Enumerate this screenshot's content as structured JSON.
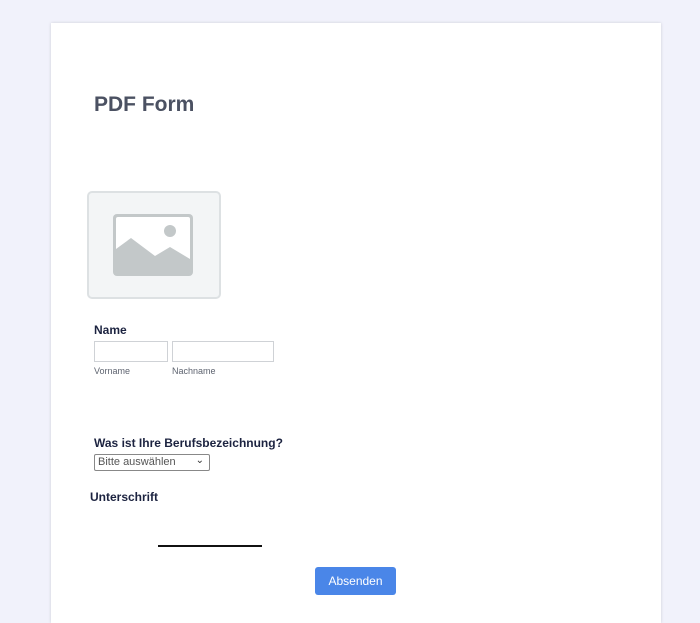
{
  "form": {
    "title": "PDF Form",
    "image_icon": "image-placeholder-icon",
    "name_label": "Name",
    "first_name": {
      "value": "",
      "sublabel": "Vorname"
    },
    "last_name": {
      "value": "",
      "sublabel": "Nachname"
    },
    "job_label": "Was ist Ihre Berufsbezeichnung?",
    "job_select": {
      "selected": "Bitte auswählen"
    },
    "signature_label": "Unterschrift",
    "submit_label": "Absenden",
    "accent": "#4a86e8"
  }
}
